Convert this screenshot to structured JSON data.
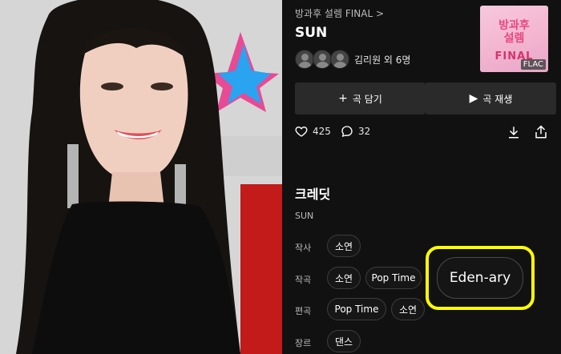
{
  "album": {
    "link_text": "방과후 설렘 FINAL",
    "cover": {
      "line1": "방과후",
      "line2": "설렘",
      "line3": "FINAL",
      "badge": "FLAC"
    }
  },
  "song": {
    "title": "SUN",
    "artists": "김리원 외 6명"
  },
  "actions": {
    "add_label": "곡 담기",
    "play_label": "곡 재생"
  },
  "stats": {
    "likes": "425",
    "comments": "32"
  },
  "credits": {
    "title": "크레딧",
    "song": "SUN",
    "lyrics_label": "작사",
    "lyrics": [
      "소연"
    ],
    "composer_label": "작곡",
    "composers": [
      "소연",
      "Pop Time"
    ],
    "arranger_label": "편곡",
    "arrangers": [
      "Pop Time",
      "소연"
    ],
    "genre_label": "장르",
    "genres": [
      "댄스"
    ]
  },
  "highlight": {
    "label": "Eden-ary",
    "color": "#ffff00"
  },
  "icons": {
    "chevron": "chevron-right-icon",
    "like": "heart-icon",
    "comment": "comment-icon",
    "download": "download-icon",
    "share": "share-icon",
    "add": "plus-icon",
    "play": "play-icon"
  }
}
